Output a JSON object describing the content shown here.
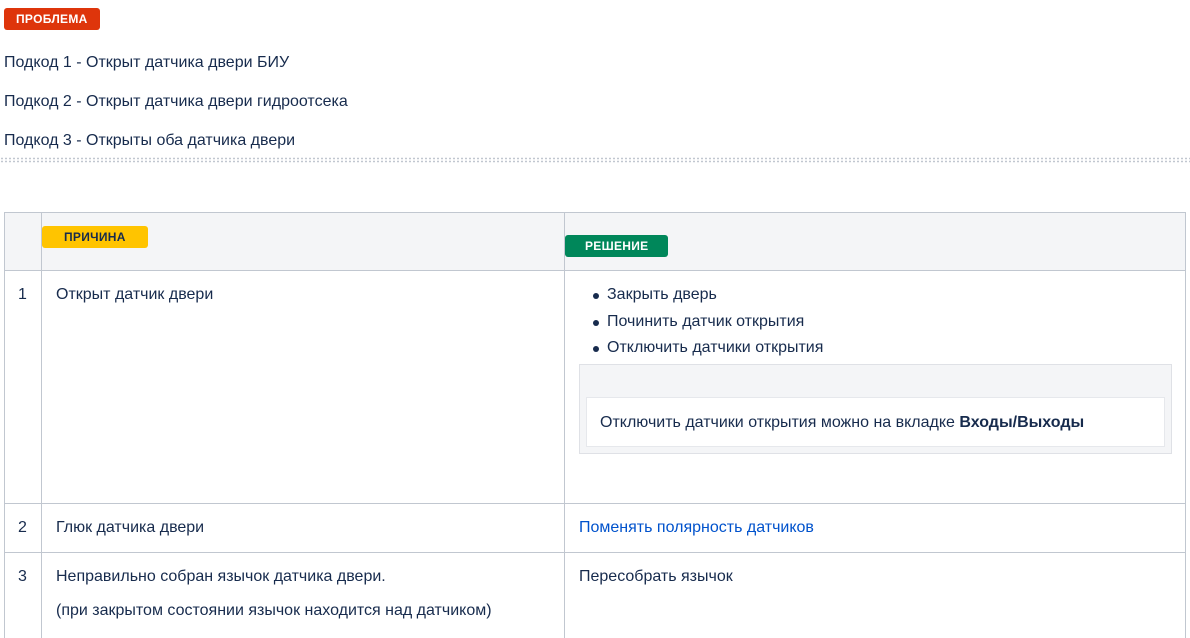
{
  "problem": {
    "label": "ПРОБЛЕМА",
    "color": "#de350b"
  },
  "subcodes": [
    "Подкод 1 - Открыт датчика двери БИУ",
    "Подкод 2 - Открыт датчика двери гидроотсека",
    "Подкод 3 - Открыты оба датчика двери"
  ],
  "table": {
    "header": {
      "cause_label": "ПРИЧИНА",
      "solution_label": "РЕШЕНИЕ",
      "cause_color": "#ffc400",
      "solution_color": "#00875a"
    },
    "rows": [
      {
        "num": "1",
        "cause": "Открыт датчик двери",
        "solutions": [
          "Закрыть дверь",
          "Починить датчик открытия",
          "Отключить датчики открытия"
        ],
        "note": {
          "text": "Отключить датчики открытия можно на вкладке ",
          "bold": "Входы/Выходы"
        }
      },
      {
        "num": "2",
        "cause": "Глюк датчика двери",
        "solution_link": "Поменять полярность датчиков"
      },
      {
        "num": "3",
        "cause": "Неправильно собран язычок датчика двери.",
        "cause_note": "(при закрытом состоянии язычок находится над датчиком)",
        "solution": "Пересобрать язычок"
      }
    ]
  }
}
